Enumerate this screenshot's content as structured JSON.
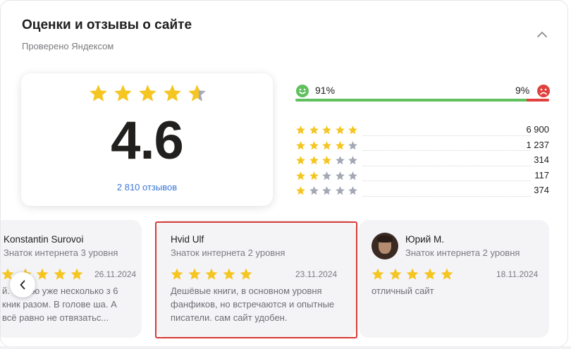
{
  "header": {
    "title": "Оценки и отзывы о сайте",
    "subtitle": "Проверено Яндексом",
    "collapse_icon": "chevron-up-icon"
  },
  "rating": {
    "score": "4.6",
    "score_value": 4.6,
    "max_stars": 5,
    "reviews_link": "2 810 отзывов"
  },
  "sentiment": {
    "positive_label": "91%",
    "negative_label": "9%",
    "positive_fraction": 0.91,
    "negative_fraction": 0.09,
    "positive_icon": "smile-icon",
    "negative_icon": "sad-face-icon"
  },
  "distribution": [
    {
      "stars": 5,
      "count": "6 900"
    },
    {
      "stars": 4,
      "count": "1 237"
    },
    {
      "stars": 3,
      "count": "314"
    },
    {
      "stars": 2,
      "count": "117"
    },
    {
      "stars": 1,
      "count": "374"
    }
  ],
  "reviews": [
    {
      "author": "Konstantin Surovoi",
      "level": "Знаток интернета 3 уровня",
      "stars": 5,
      "date": "26.11.2024",
      "text": "й. Читаю уже несколько з 6 кник разом. В голове ша. А всё равно не отвязатьс..."
    },
    {
      "author": "Hvid Ulf",
      "level": "Знаток интернета 2 уровня",
      "stars": 5,
      "date": "23.11.2024",
      "text": "Дешёвые книги, в основном уровня фанфиков, но встречаются и опытные писатели. сам сайт удобен."
    },
    {
      "author": "Юрий М.",
      "level": "Знаток интернета 2 уровня",
      "stars": 5,
      "date": "18.11.2024",
      "text": "отличный сайт"
    }
  ],
  "colors": {
    "star_filled": "#f5c521",
    "star_empty": "#a3a8b4",
    "positive": "#5fc05d",
    "negative": "#e0413e",
    "link": "#3b78d8",
    "highlight": "#d83a34"
  },
  "icons": {
    "prev": "chevron-left-icon",
    "star": "star-icon",
    "avatar": "avatar"
  }
}
